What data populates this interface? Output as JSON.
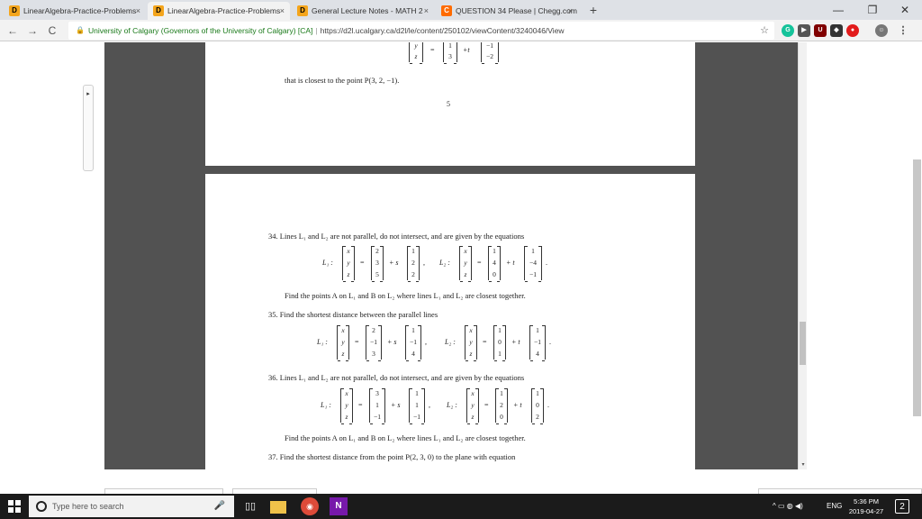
{
  "tabs": [
    {
      "title": "LinearAlgebra-Practice-Problems",
      "icon": "d2l-icon",
      "active": false
    },
    {
      "title": "LinearAlgebra-Practice-Problems",
      "icon": "d2l-icon",
      "active": true
    },
    {
      "title": "General Lecture Notes - MATH 2",
      "icon": "d2l-icon",
      "active": false
    },
    {
      "title": "QUESTION 34 Please | Chegg.com",
      "icon": "chegg-icon",
      "active": false
    }
  ],
  "tab_favicon_letter": "D",
  "chegg_favicon_letter": "C",
  "new_tab": "+",
  "close_glyph": "×",
  "window": {
    "minimize": "—",
    "restore": "❐",
    "close": "✕"
  },
  "nav": {
    "back": "←",
    "forward": "→",
    "reload": "C"
  },
  "address": {
    "org": "University of Calgary (Governors of the University of Calgary) [CA]",
    "separator": "|",
    "url": "https://d2l.ucalgary.ca/d2l/le/content/250102/viewContent/3240046/View",
    "star": "☆"
  },
  "extensions": [
    {
      "name": "grammarly-icon",
      "letter": "G",
      "color": "#15c39a"
    },
    {
      "name": "media-icon",
      "letter": "▶",
      "color": "#555555"
    },
    {
      "name": "ublock-icon",
      "letter": "U",
      "color": "#800000"
    },
    {
      "name": "cast-icon",
      "letter": "◆",
      "color": "#333333"
    },
    {
      "name": "record-icon",
      "letter": "●",
      "color": "#e21b1b"
    },
    {
      "name": "profile-icon",
      "letter": "☺",
      "color": "#777777"
    },
    {
      "name": "menu-icon",
      "letter": "⋮",
      "color": "#f2f2f2"
    }
  ],
  "viewer": {
    "collapse_arrow": "▸",
    "zoom_fit": "⇳",
    "zoom_in": "+",
    "zoom_out": "−",
    "scroll_down": "▾"
  },
  "page1": {
    "eq_top": {
      "lhs": [
        "y",
        "z"
      ],
      "p": [
        "1",
        "3"
      ],
      "t": "+t",
      "d": [
        "−1",
        "−2"
      ]
    },
    "closest_text": "that is closest to the point P(3, 2, −1).",
    "page_number": "5"
  },
  "page2": {
    "q34": {
      "text": "34.  Lines L₁ and L₂ are not parallel, do not intersect, and are given by the equations",
      "L1_label": "L₁ :",
      "L1_vars": [
        "x",
        "y",
        "z"
      ],
      "L1_point": [
        "2",
        "3",
        "5"
      ],
      "L1_param": "+ s",
      "L1_dir": [
        "1",
        "2",
        "2"
      ],
      "comma": ",",
      "L2_label": "L₂ :",
      "L2_vars": [
        "x",
        "y",
        "z"
      ],
      "L2_point": [
        "1",
        "4",
        "0"
      ],
      "L2_param": "+ t",
      "L2_dir": [
        "1",
        "−4",
        "−1"
      ],
      "find": "Find the points A on L₁ and B on L₂ where lines L₁ and L₂ are closest together."
    },
    "q35": {
      "text": "35.  Find the shortest distance between the parallel lines",
      "L1_label": "L₁ :",
      "L1_vars": [
        "x",
        "y",
        "z"
      ],
      "L1_point": [
        "2",
        "−1",
        "3"
      ],
      "L1_param": "+ s",
      "L1_dir": [
        "1",
        "−1",
        "4"
      ],
      "comma": ",",
      "L2_label": "L₂ :",
      "L2_vars": [
        "x",
        "y",
        "z"
      ],
      "L2_point": [
        "1",
        "0",
        "1"
      ],
      "L2_param": "+ t",
      "L2_dir": [
        "1",
        "−1",
        "4"
      ]
    },
    "q36": {
      "text": "36.  Lines L₁ and L₂ are not parallel, do not intersect, and are given by the equations",
      "L1_label": "L₁ :",
      "L1_vars": [
        "x",
        "y",
        "z"
      ],
      "L1_point": [
        "3",
        "1",
        "−1"
      ],
      "L1_param": "+ s",
      "L1_dir": [
        "1",
        "1",
        "−1"
      ],
      "comma": ",",
      "L2_label": "L₂ :",
      "L2_vars": [
        "x",
        "y",
        "z"
      ],
      "L2_point": [
        "1",
        "2",
        "0"
      ],
      "L2_param": "+ t",
      "L2_dir": [
        "1",
        "0",
        "2"
      ],
      "find": "Find the points A on L₁ and B on L₂ where lines L₁ and L₂ are closest together."
    },
    "q37": {
      "text": "37.  Find the shortest distance from the point P(2, 3, 0) to the plane with equation"
    }
  },
  "equals": "=",
  "period": ".",
  "taskbar": {
    "search_placeholder": "Type here to search",
    "mic": "🎤",
    "tray_text": "ENG",
    "tray_icons": "^ ▭ ◍ ◀)",
    "time": "5:36 PM",
    "date": "2019-04-27",
    "notification_count": "2"
  }
}
